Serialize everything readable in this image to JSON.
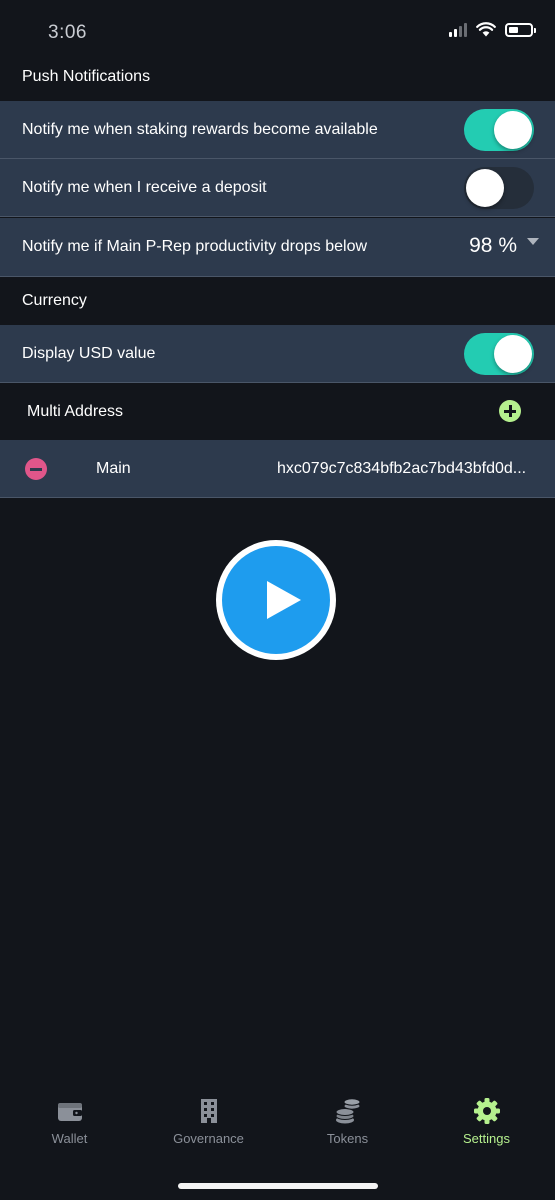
{
  "status_bar": {
    "time": "3:06",
    "signal_icon": "signal-icon",
    "wifi_icon": "wifi-icon",
    "battery_icon": "battery-icon"
  },
  "push_notifications": {
    "title": "Push Notifications",
    "items": [
      {
        "label": "Notify me when staking rewards become available",
        "enabled": true
      },
      {
        "label": "Notify me when I receive a deposit",
        "enabled": false
      },
      {
        "label": "Notify me if Main P-Rep productivity drops below",
        "value": "98 %"
      }
    ]
  },
  "currency": {
    "title": "Currency",
    "items": [
      {
        "label": "Display USD value",
        "enabled": true
      }
    ]
  },
  "multi_address": {
    "title": "Multi Address",
    "add_icon": "plus-circle-icon",
    "remove_icon": "minus-circle-icon",
    "addresses": [
      {
        "name": "Main",
        "address": "hxc079c7c834bfb2ac7bd43bfd0d..."
      }
    ]
  },
  "video": {
    "play_icon": "play-icon"
  },
  "tab_bar": {
    "tabs": [
      {
        "label": "Wallet",
        "icon": "wallet-icon",
        "active": false
      },
      {
        "label": "Governance",
        "icon": "building-icon",
        "active": false
      },
      {
        "label": "Tokens",
        "icon": "coins-icon",
        "active": false
      },
      {
        "label": "Settings",
        "icon": "gear-icon",
        "active": true
      }
    ]
  },
  "colors": {
    "background": "#12151b",
    "row_background": "#2d3a4d",
    "toggle_on": "#23ccb2",
    "toggle_off": "#252e3a",
    "accent_green": "#b5f08e",
    "remove_pink": "#e0568a",
    "play_blue": "#1e9cee",
    "inactive_tab": "#8b9099"
  }
}
